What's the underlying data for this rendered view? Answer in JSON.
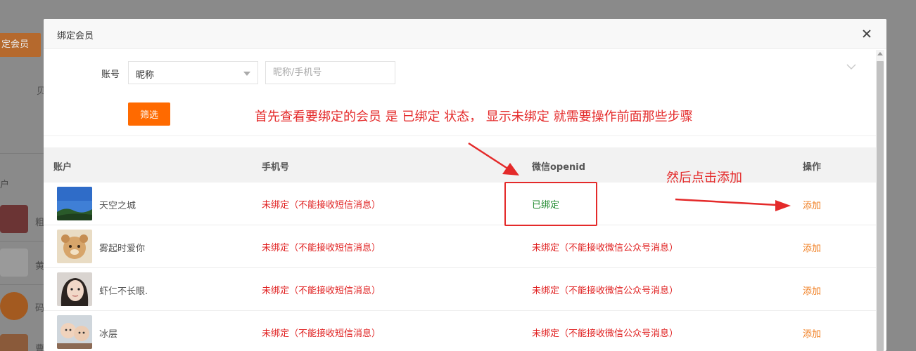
{
  "background": {
    "bind_button_label": "定会员",
    "fragment_text": "贝",
    "column_fragment": "户",
    "row_fragments": [
      "粗",
      "黄",
      "码",
      "曹"
    ]
  },
  "modal": {
    "title": "绑定会员",
    "filter": {
      "account_label": "账号",
      "select_value": "昵称",
      "input_placeholder": "昵称/手机号",
      "submit_label": "筛选"
    },
    "annotations": {
      "top_note": "首先查看要绑定的会员 是 已绑定  状态， 显示未绑定 就需要操作前面那些步骤",
      "right_note": "然后点击添加"
    },
    "table": {
      "headers": [
        "账户",
        "手机号",
        "微信openid",
        "操作"
      ],
      "rows": [
        {
          "name": "天空之城",
          "phone": "未绑定（不能接收短信消息）",
          "openid": "已绑定",
          "bound": true,
          "action": "添加",
          "avatar": "sky-avatar"
        },
        {
          "name": "雾起时爱你",
          "phone": "未绑定（不能接收短信消息）",
          "openid": "未绑定（不能接收微信公众号消息）",
          "bound": false,
          "action": "添加",
          "avatar": "bear-avatar"
        },
        {
          "name": "虾仁不长眼.",
          "phone": "未绑定（不能接收短信消息）",
          "openid": "未绑定（不能接收微信公众号消息）",
          "bound": false,
          "action": "添加",
          "avatar": "girl-avatar"
        },
        {
          "name": "冰层",
          "phone": "未绑定（不能接收短信消息）",
          "openid": "未绑定（不能接收微信公众号消息）",
          "bound": false,
          "action": "添加",
          "avatar": "kids-avatar"
        }
      ]
    }
  },
  "colors": {
    "accent": "#ff6a00",
    "annotation": "#e42a2a",
    "unbound": "#e02020",
    "bound": "#1f8a2e",
    "action": "#f07b1b"
  }
}
